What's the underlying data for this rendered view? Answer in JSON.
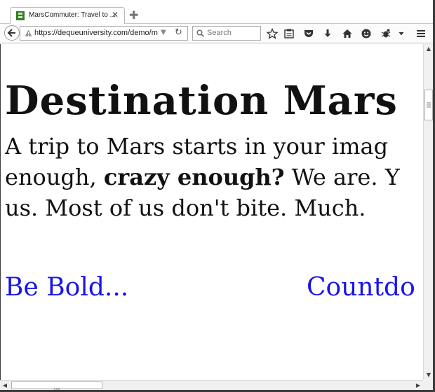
{
  "browser": {
    "tab": {
      "title": "MarsCommuter: Travel to ...",
      "close": "✕"
    },
    "newtab": "✚",
    "url": "https://dequeuniversity.com/demo/m",
    "search_placeholder": "Search",
    "icons": [
      "back-icon",
      "warning-icon",
      "url-dropdown-icon",
      "reload-icon",
      "search-icon",
      "bookmark-star-icon",
      "reader-icon",
      "pocket-icon",
      "download-icon",
      "home-icon",
      "smiley-icon",
      "bug-icon",
      "dropdown-icon",
      "menu-icon"
    ]
  },
  "page": {
    "title": "Destination Mars",
    "intro": {
      "line1": "A trip to Mars starts in your imag",
      "line2_start": "enough, ",
      "line2_bold": "crazy enough?",
      "line2_end": " We are. Y",
      "line3": "us. Most of us don't bite. Much."
    },
    "links": {
      "be_bold": "Be Bold...",
      "countdown": "Countdo"
    }
  },
  "colors": {
    "link": "#1a14e8",
    "text": "#111111"
  }
}
